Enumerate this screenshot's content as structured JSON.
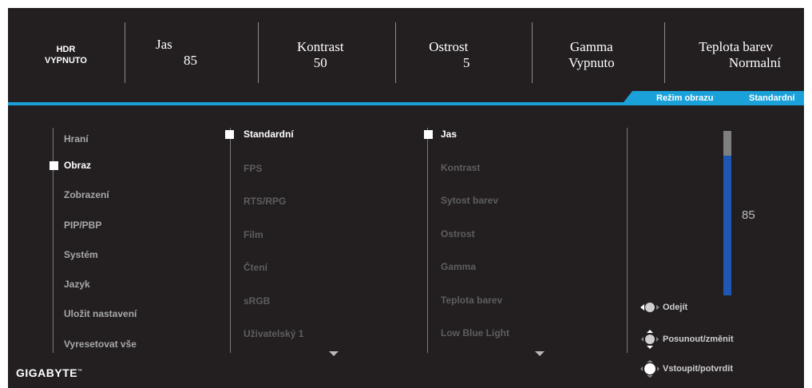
{
  "status_bar": {
    "hdr_label": "HDR",
    "hdr_value": "VYPNUTO",
    "jas_label": "Jas",
    "jas_value": "85",
    "kontrast_label": "Kontrast",
    "kontrast_value": "50",
    "ostrost_label": "Ostrost",
    "ostrost_value": "5",
    "gamma_label": "Gamma",
    "gamma_value": "Vypnuto",
    "teplota_label": "Teplota barev",
    "teplota_value": "Normalní"
  },
  "mode_tab": {
    "label": "Režim obrazu",
    "value": "Standardní",
    "color": "#1ba1d9"
  },
  "main_menu": [
    "Hraní",
    "Obraz",
    "Zobrazení",
    "PIP/PBP",
    "Systém",
    "Jazyk",
    "Uložit nastavení",
    "Vyresetovat vše"
  ],
  "main_menu_selected": "Obraz",
  "mode_menu": [
    "Standardní",
    "FPS",
    "RTS/RPG",
    "Film",
    "Čtení",
    "sRGB",
    "Uživatelský 1"
  ],
  "mode_menu_selected": "Standardní",
  "setting_menu": [
    "Jas",
    "Kontrast",
    "Sytost barev",
    "Ostrost",
    "Gamma",
    "Teplota barev",
    "Low Blue Light"
  ],
  "setting_menu_selected": "Jas",
  "slider": {
    "value": "85",
    "level": 0.85,
    "fill_color": "#1f56b4"
  },
  "hints": {
    "exit": "Odejít",
    "move": "Posunout/změnit",
    "enter": "Vstoupit/potvrdit"
  },
  "brand": "GIGABYTE",
  "brand_mark": "™"
}
